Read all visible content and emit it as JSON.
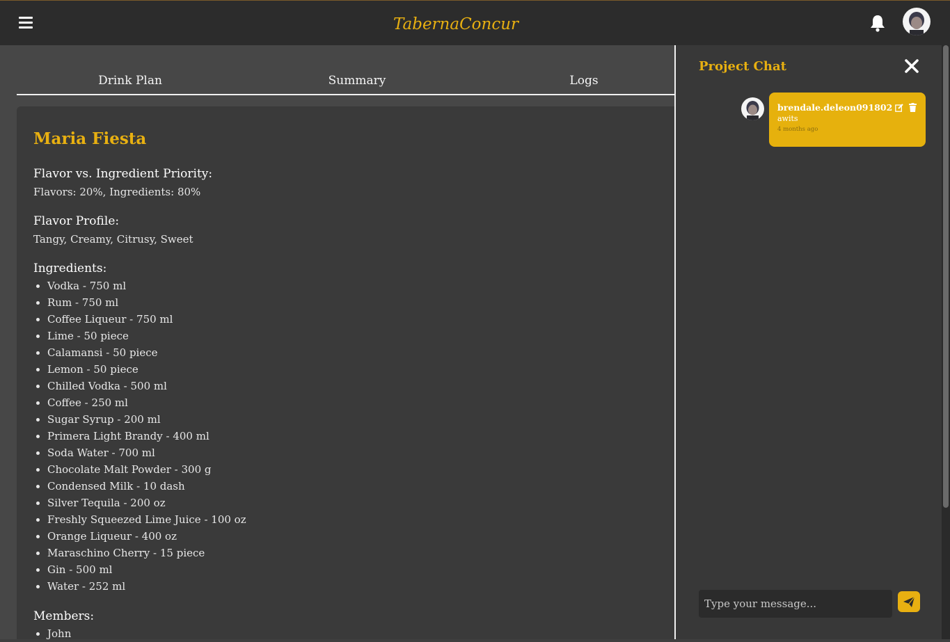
{
  "header": {
    "brand": "TabernaConcur",
    "menu_icon": "hamburger-menu-icon",
    "notification_icon": "bell-icon",
    "brand_color": "#e8b011"
  },
  "tabs": [
    {
      "label": "Drink Plan"
    },
    {
      "label": "Summary"
    },
    {
      "label": "Logs"
    }
  ],
  "recipe": {
    "title": "Maria Fiesta",
    "priority_label": "Flavor vs. Ingredient Priority:",
    "priority_value": "Flavors: 20%, Ingredients: 80%",
    "flavor_label": "Flavor Profile:",
    "flavor_value": "Tangy, Creamy, Citrusy, Sweet",
    "ingredients_label": "Ingredients:",
    "ingredients": [
      "Vodka - 750 ml",
      "Rum - 750 ml",
      "Coffee Liqueur - 750 ml",
      "Lime - 50 piece",
      "Calamansi - 50 piece",
      "Lemon - 50 piece",
      "Chilled Vodka - 500 ml",
      "Coffee - 250 ml",
      "Sugar Syrup - 200 ml",
      "Primera Light Brandy - 400 ml",
      "Soda Water - 700 ml",
      "Chocolate Malt Powder - 300 g",
      "Condensed Milk - 10 dash",
      "Silver Tequila - 200 oz",
      "Freshly Squeezed Lime Juice - 100 oz",
      "Orange Liqueur - 400 oz",
      "Maraschino Cherry - 15 piece",
      "Gin - 500 ml",
      "Water - 252 ml"
    ],
    "members_label": "Members:",
    "members": [
      "John"
    ]
  },
  "chat": {
    "title": "Project Chat",
    "close_icon": "close-icon",
    "messages": [
      {
        "user": "brendale.deleon091802",
        "text": "awits",
        "time": "4 months ago"
      }
    ],
    "input_placeholder": "Type your message...",
    "send_icon": "paper-plane-icon"
  }
}
